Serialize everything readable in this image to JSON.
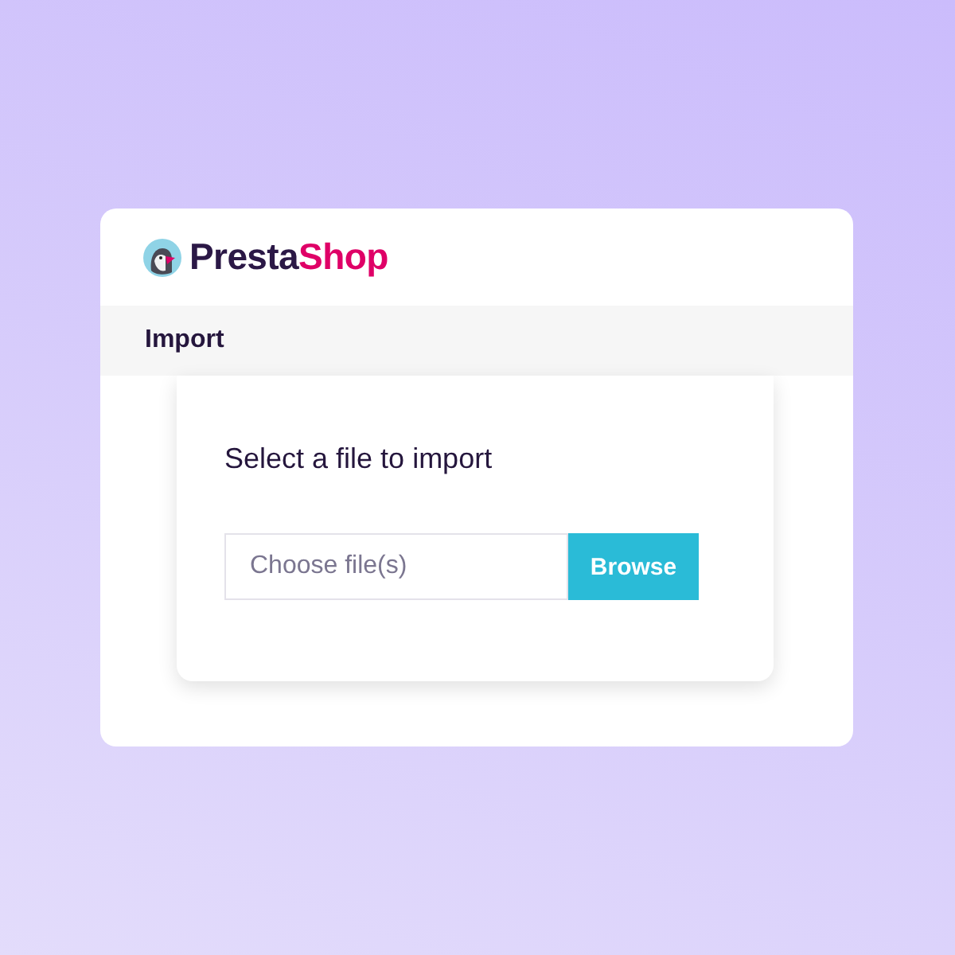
{
  "logo": {
    "parts": [
      {
        "text": "Presta",
        "color": "#2b1846"
      },
      {
        "text": "Shop",
        "color": "#df0067"
      }
    ]
  },
  "section": {
    "title": "Import"
  },
  "form": {
    "heading": "Select a file to import",
    "file_field": {
      "placeholder": "Choose file(s)"
    },
    "button": "Browse"
  }
}
